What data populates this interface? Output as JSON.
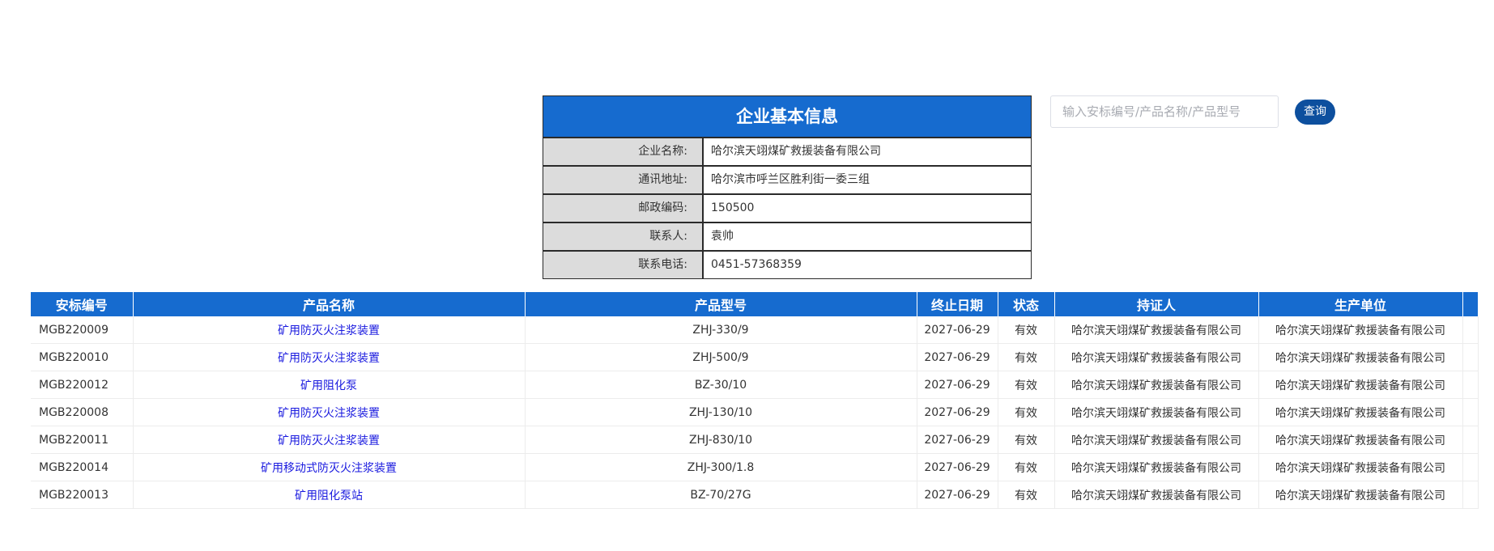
{
  "company_info": {
    "title": "企业基本信息",
    "rows": [
      {
        "label": "企业名称:",
        "value": "哈尔滨天翊煤矿救援装备有限公司"
      },
      {
        "label": "通讯地址:",
        "value": "哈尔滨市呼兰区胜利街一委三组"
      },
      {
        "label": "邮政编码:",
        "value": "150500"
      },
      {
        "label": "联系人:",
        "value": "袁帅"
      },
      {
        "label": "联系电话:",
        "value": "0451-57368359"
      }
    ]
  },
  "search": {
    "placeholder": "输入安标编号/产品名称/产品型号",
    "value": "",
    "button_label": "查询"
  },
  "products": {
    "columns": [
      "安标编号",
      "产品名称",
      "产品型号",
      "终止日期",
      "状态",
      "持证人",
      "生产单位",
      ""
    ],
    "rows": [
      {
        "id": "MGB220009",
        "name": "矿用防灭火注浆装置",
        "model": "ZHJ-330/9",
        "end_date": "2027-06-29",
        "status": "有效",
        "holder": "哈尔滨天翊煤矿救援装备有限公司",
        "manufacturer": "哈尔滨天翊煤矿救援装备有限公司"
      },
      {
        "id": "MGB220010",
        "name": "矿用防灭火注浆装置",
        "model": "ZHJ-500/9",
        "end_date": "2027-06-29",
        "status": "有效",
        "holder": "哈尔滨天翊煤矿救援装备有限公司",
        "manufacturer": "哈尔滨天翊煤矿救援装备有限公司"
      },
      {
        "id": "MGB220012",
        "name": "矿用阻化泵",
        "model": "BZ-30/10",
        "end_date": "2027-06-29",
        "status": "有效",
        "holder": "哈尔滨天翊煤矿救援装备有限公司",
        "manufacturer": "哈尔滨天翊煤矿救援装备有限公司"
      },
      {
        "id": "MGB220008",
        "name": "矿用防灭火注浆装置",
        "model": "ZHJ-130/10",
        "end_date": "2027-06-29",
        "status": "有效",
        "holder": "哈尔滨天翊煤矿救援装备有限公司",
        "manufacturer": "哈尔滨天翊煤矿救援装备有限公司"
      },
      {
        "id": "MGB220011",
        "name": "矿用防灭火注浆装置",
        "model": "ZHJ-830/10",
        "end_date": "2027-06-29",
        "status": "有效",
        "holder": "哈尔滨天翊煤矿救援装备有限公司",
        "manufacturer": "哈尔滨天翊煤矿救援装备有限公司"
      },
      {
        "id": "MGB220014",
        "name": "矿用移动式防灭火注浆装置",
        "model": "ZHJ-300/1.8",
        "end_date": "2027-06-29",
        "status": "有效",
        "holder": "哈尔滨天翊煤矿救援装备有限公司",
        "manufacturer": "哈尔滨天翊煤矿救援装备有限公司"
      },
      {
        "id": "MGB220013",
        "name": "矿用阻化泵站",
        "model": "BZ-70/27G",
        "end_date": "2027-06-29",
        "status": "有效",
        "holder": "哈尔滨天翊煤矿救援装备有限公司",
        "manufacturer": "哈尔滨天翊煤矿救援装备有限公司"
      }
    ]
  },
  "colors": {
    "header_blue": "#166bcf",
    "button_blue": "#0d4f9e",
    "link_blue": "#1a1adf",
    "label_bg": "#dcdcdc"
  }
}
